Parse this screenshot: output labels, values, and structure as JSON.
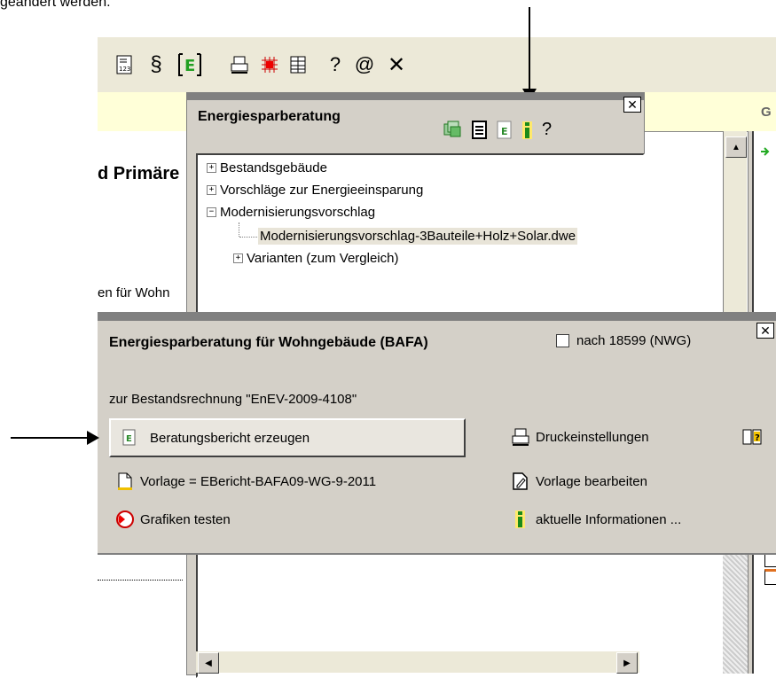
{
  "doc_text": "geändert werden.",
  "toolbar": {
    "icons": [
      "list-numbers-icon",
      "paragraph-icon",
      "energy-e-icon",
      "print-icon",
      "grid-red-icon",
      "table-icon",
      "help-icon",
      "email-icon",
      "close-icon"
    ],
    "help_label": "?",
    "email_label": "@",
    "close_label": "✕"
  },
  "background": {
    "g_letter": "G",
    "left_heading_fragment": "d Primäre",
    "left_text_fragment": "en für Wohn"
  },
  "energy_window": {
    "title": "Energiesparberatung",
    "help_label": "?",
    "close_label": "✕",
    "tree": [
      {
        "label": "Bestandsgebäude",
        "expander": "+"
      },
      {
        "label": "Vorschläge zur Energieeinsparung",
        "expander": "+"
      },
      {
        "label": "Modernisierungsvorschlag",
        "expander": "−"
      },
      {
        "label": "Modernisierungsvorschlag-3Bauteile+Holz+Solar.dwe",
        "expander": ""
      },
      {
        "label": "Varianten (zum Vergleich)",
        "expander": "+"
      }
    ]
  },
  "bafa_dialog": {
    "title": "Energiesparberatung für Wohngebäude (BAFA)",
    "checkbox_label": "nach 18599 (NWG)",
    "checkbox_checked": false,
    "close_label": "✕",
    "subtitle": "zur Bestandsrechnung \"EnEV-2009-4108\"",
    "generate_button": "Beratungsbericht erzeugen",
    "template_label": "Vorlage = EBericht-BAFA09-WG-9-2011",
    "test_graphics": "Grafiken testen",
    "print_settings": "Druckeinstellungen",
    "edit_template": "Vorlage bearbeiten",
    "current_info": "aktuelle Informationen ..."
  }
}
